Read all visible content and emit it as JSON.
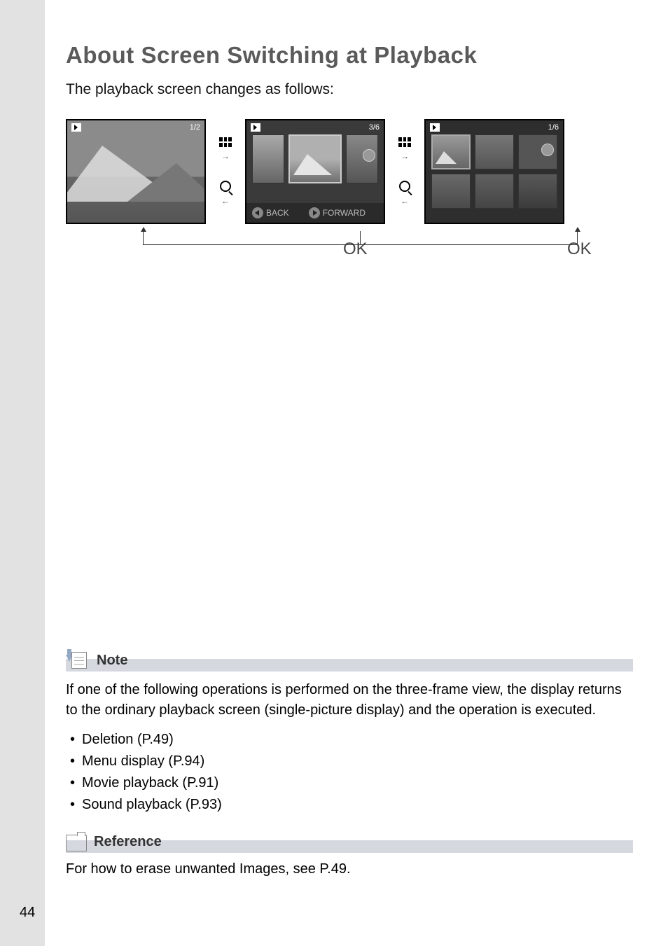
{
  "page": {
    "number": "44",
    "title": "About Screen Switching at Playback",
    "intro": "The playback screen changes as follows:"
  },
  "diagram": {
    "screen1_counter": "1/2",
    "screen2_counter": "3/6",
    "screen3_counter": "1/6",
    "back_label": "BACK",
    "forward_label": "FORWARD",
    "ok_label": "OK"
  },
  "note": {
    "heading": "Note",
    "text": "If one of the following operations is performed on the three-frame view, the display returns to the ordinary playback screen (single-picture display) and the operation is executed.",
    "bullets": [
      "Deletion (P.49)",
      "Menu display (P.94)",
      "Movie playback (P.91)",
      "Sound playback (P.93)"
    ]
  },
  "reference": {
    "heading": "Reference",
    "text": "For how to erase unwanted Images, see P.49."
  }
}
